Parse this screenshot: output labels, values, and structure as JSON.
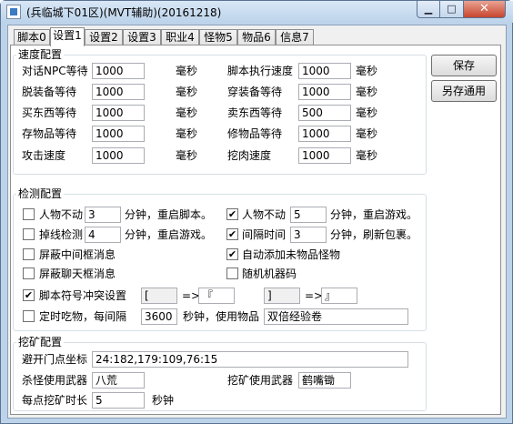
{
  "window": {
    "title": "(兵临城下01区)(MVT辅助)(20161218)",
    "minimize_label": "▁",
    "maximize_label": "□",
    "close_label": "✕"
  },
  "tabs": [
    "脚本0",
    "设置1",
    "设置2",
    "设置3",
    "职业4",
    "怪物5",
    "物品6",
    "信息7"
  ],
  "buttons": {
    "save": "保存",
    "save_as_generic": "另存通用"
  },
  "speed": {
    "title": "速度配置",
    "unit": "毫秒",
    "rows": [
      {
        "left_label": "对话NPC等待",
        "left_value": "1000",
        "right_label": "脚本执行速度",
        "right_value": "1000"
      },
      {
        "left_label": "脱装备等待",
        "left_value": "1000",
        "right_label": "穿装备等待",
        "right_value": "1000"
      },
      {
        "left_label": "买东西等待",
        "left_value": "1000",
        "right_label": "卖东西等待",
        "right_value": "500"
      },
      {
        "left_label": "存物品等待",
        "left_value": "1000",
        "right_label": "修物品等待",
        "right_value": "1000"
      },
      {
        "left_label": "攻击速度",
        "left_value": "1000",
        "right_label": "挖肉速度",
        "right_value": "1000"
      }
    ]
  },
  "detect": {
    "title": "检测配置",
    "idle_label": "人物不动",
    "idle_value": "3",
    "idle_suffix": "分钟，重启脚本。",
    "idle_checked": false,
    "idle2_label": "人物不动",
    "idle2_value": "5",
    "idle2_suffix": "分钟，重启游戏。",
    "idle2_checked": true,
    "disconnect_label": "掉线检测",
    "disconnect_value": "4",
    "disconnect_suffix": "分钟，重启游戏。",
    "disconnect_checked": false,
    "interval_label": "间隔时间",
    "interval_value": "3",
    "interval_suffix": "分钟，刷新包裹。",
    "interval_checked": true,
    "block_middle_label": "屏蔽中间框消息",
    "block_middle_checked": false,
    "auto_add_label": "自动添加未物品怪物",
    "auto_add_checked": true,
    "block_chat_label": "屏蔽聊天框消息",
    "block_chat_checked": false,
    "random_code_label": "随机机器码",
    "random_code_checked": false,
    "symbol_label": "脚本符号冲突设置",
    "symbol_checked": true,
    "symbol_from1": "[",
    "arrow1": "=>",
    "symbol_to1": "『",
    "symbol_from2": "]",
    "arrow2": "=>",
    "symbol_to2": "』",
    "timed_eat_label": "定时吃物，每间隔",
    "timed_eat_checked": false,
    "timed_eat_value": "3600",
    "timed_eat_suffix": "秒钟，使用物品",
    "timed_eat_item": "双倍经验卷"
  },
  "mining": {
    "title": "挖矿配置",
    "portal_label": "避开门点坐标",
    "portal_value": "24:182,179:109,76:15",
    "kill_weapon_label": "杀怪使用武器",
    "kill_weapon_value": "八荒",
    "mine_weapon_label": "挖矿使用武器",
    "mine_weapon_value": "鹤嘴锄",
    "duration_label": "每点挖矿时长",
    "duration_value": "5",
    "duration_unit": "秒钟"
  }
}
